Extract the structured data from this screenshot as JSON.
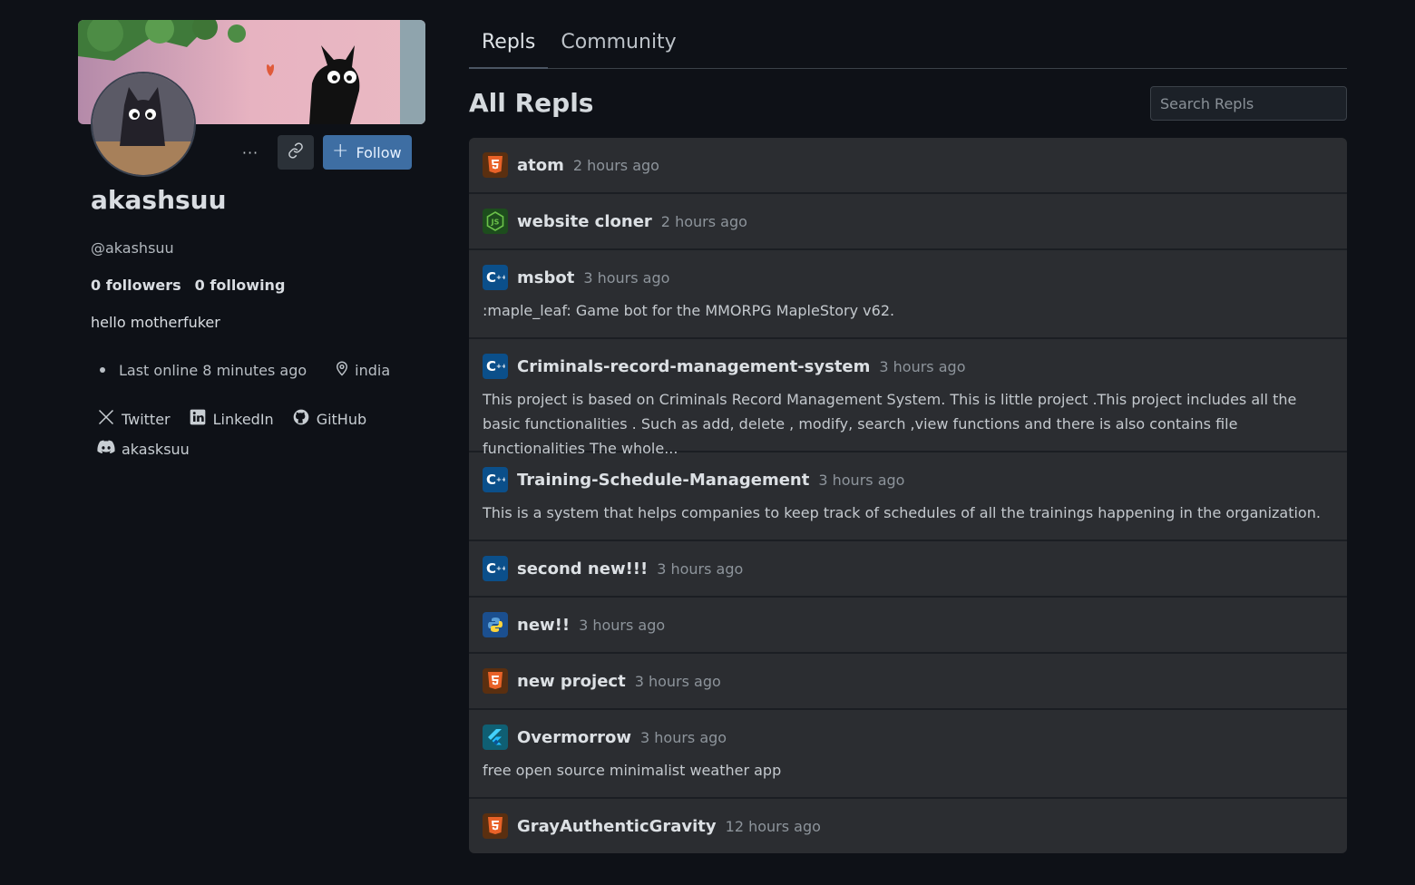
{
  "profile": {
    "username": "akashsuu",
    "handle": "@akashsuu",
    "followers": "0 followers",
    "following": "0 following",
    "bio": "hello motherfuker",
    "last_online": "Last online 8 minutes ago",
    "location": "india",
    "follow_label": "Follow",
    "more_label": "···",
    "socials": [
      {
        "label": "Twitter",
        "icon": "x-icon"
      },
      {
        "label": "LinkedIn",
        "icon": "linkedin-icon"
      },
      {
        "label": "GitHub",
        "icon": "github-icon"
      }
    ],
    "discord": "akasksuu"
  },
  "tabs": [
    {
      "label": "Repls",
      "active": true
    },
    {
      "label": "Community",
      "active": false
    }
  ],
  "section_title": "All Repls",
  "search": {
    "placeholder": "Search Repls"
  },
  "repls": [
    {
      "title": "atom",
      "time": "2 hours ago",
      "lang": "html-icon",
      "desc": ""
    },
    {
      "title": "website cloner",
      "time": "2 hours ago",
      "lang": "nodejs-icon",
      "desc": ""
    },
    {
      "title": "msbot",
      "time": "3 hours ago",
      "lang": "cpp-icon",
      "desc": ":maple_leaf: Game bot for the MMORPG MapleStory v62."
    },
    {
      "title": "Criminals-record-management-system",
      "time": "3 hours ago",
      "lang": "cpp-icon",
      "desc": "This project is based on Criminals Record Management System. This is little project .This project includes all the basic functionalities . Such as add, delete , modify, search ,view functions and there is also contains file functionalities The whole..."
    },
    {
      "title": "Training-Schedule-Management",
      "time": "3 hours ago",
      "lang": "cpp-icon",
      "desc": "This is a system that helps companies to keep track of schedules of all the trainings happening in the organization."
    },
    {
      "title": "second new!!!",
      "time": "3 hours ago",
      "lang": "cpp-icon",
      "desc": ""
    },
    {
      "title": "new!!",
      "time": "3 hours ago",
      "lang": "python-icon",
      "desc": ""
    },
    {
      "title": "new project",
      "time": "3 hours ago",
      "lang": "html-icon",
      "desc": ""
    },
    {
      "title": "Overmorrow",
      "time": "3 hours ago",
      "lang": "flutter-icon",
      "desc": "free open source minimalist weather app"
    },
    {
      "title": "GrayAuthenticGravity",
      "time": "12 hours ago",
      "lang": "html-icon",
      "desc": ""
    }
  ]
}
